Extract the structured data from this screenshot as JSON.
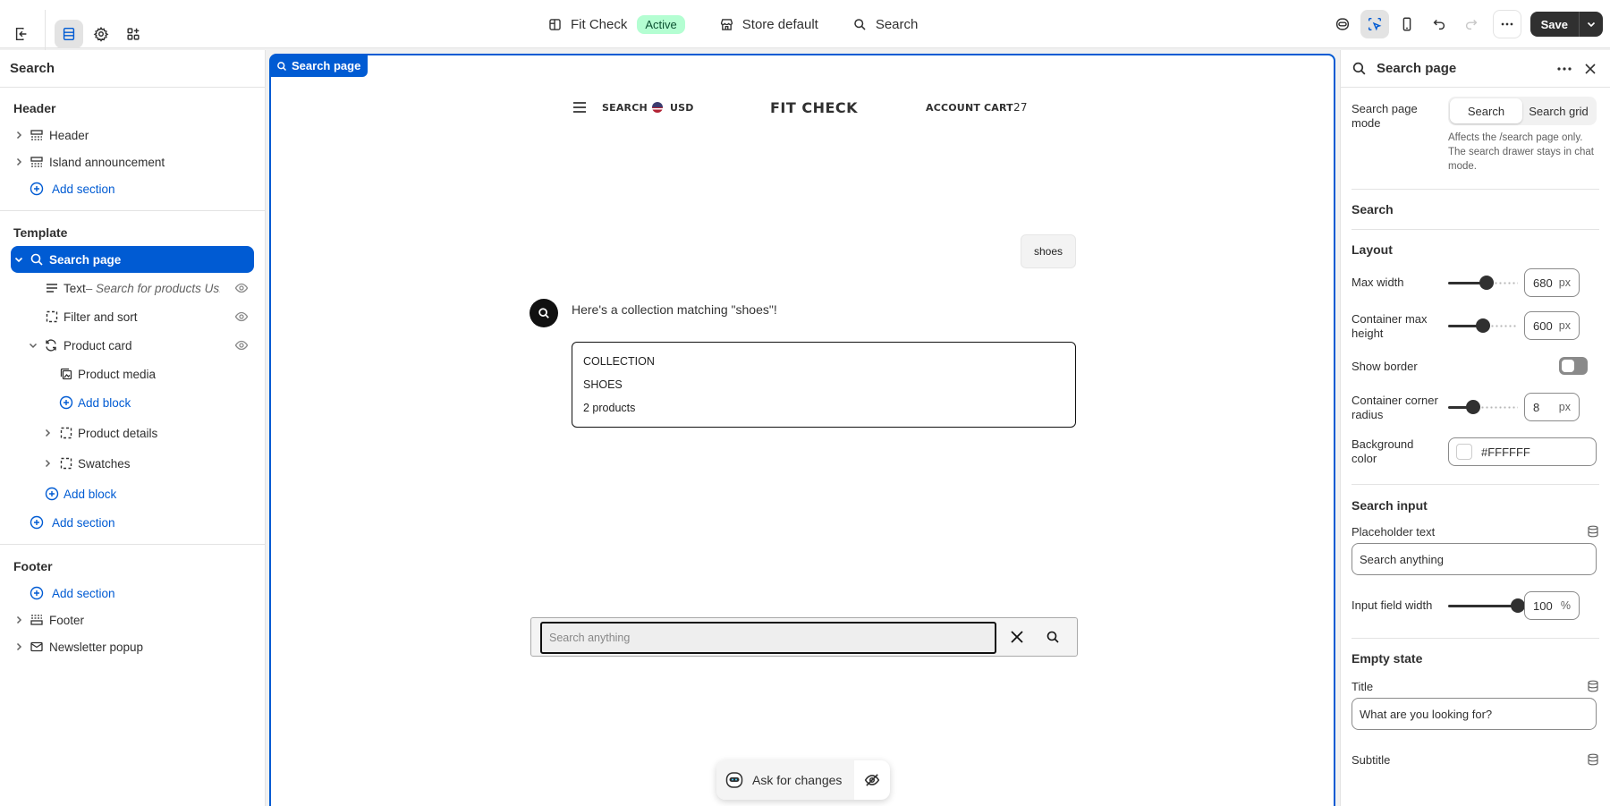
{
  "topbar": {
    "theme_name": "Fit Check",
    "theme_status": "Active",
    "store_label": "Store default",
    "page_label": "Search",
    "save_label": "Save"
  },
  "left_panel": {
    "title": "Search",
    "header_group": {
      "title": "Header",
      "items": [
        "Header",
        "Island announcement"
      ],
      "add_section": "Add section"
    },
    "template_group": {
      "title": "Template",
      "selected_item": "Search page",
      "text_block_label": "Text",
      "text_block_sub": " – Search for products Us...",
      "filter_sort": "Filter and sort",
      "product_card": "Product card",
      "product_media": "Product media",
      "add_block_inner": "Add block",
      "product_details": "Product details",
      "swatches": "Swatches",
      "add_block": "Add block",
      "add_section": "Add section"
    },
    "footer_group": {
      "title": "Footer",
      "add_section": "Add section",
      "items": [
        "Footer",
        "Newsletter popup"
      ]
    }
  },
  "canvas": {
    "tag": "Search page",
    "store_header": {
      "search": "SEARCH",
      "currency": "USD",
      "logo": "FIT CHECK",
      "account": "ACCOUNT",
      "cart": "CART",
      "cart_count": "27"
    },
    "user_message": "shoes",
    "bot_message": "Here's a collection matching \"shoes\"!",
    "collection_card": {
      "kind": "COLLECTION",
      "name": "SHOES",
      "count": "2 products"
    },
    "search_placeholder": "Search anything",
    "ask_label": "Ask for changes"
  },
  "right_panel": {
    "title": "Search page",
    "mode_label": "Search page mode",
    "mode_options": [
      "Search",
      "Search grid"
    ],
    "mode_selected": "Search",
    "mode_help": "Affects the /search page only. The search drawer stays in chat mode.",
    "search_heading": "Search",
    "layout_heading": "Layout",
    "max_width_label": "Max width",
    "max_width_value": "680",
    "max_width_level": 0.55,
    "container_height_label": "Container max height",
    "container_height_value": "600",
    "container_height_level": 0.5,
    "show_border_label": "Show border",
    "show_border_on": false,
    "corner_radius_label": "Container corner radius",
    "corner_radius_value": "8",
    "corner_radius_level": 0.36,
    "bg_color_label": "Background color",
    "bg_color_value": "#FFFFFF",
    "unit_px": "px",
    "unit_pct": "%",
    "search_input_heading": "Search input",
    "placeholder_label": "Placeholder text",
    "placeholder_value": "Search anything",
    "input_width_label": "Input field width",
    "input_width_value": "100",
    "input_width_level": 1.0,
    "empty_state_heading": "Empty state",
    "title_label": "Title",
    "title_value": "What are you looking for?",
    "subtitle_label": "Subtitle"
  },
  "colors": {
    "accent": "#005bd3",
    "active_badge": "#b4fed2",
    "dark": "#303030"
  }
}
